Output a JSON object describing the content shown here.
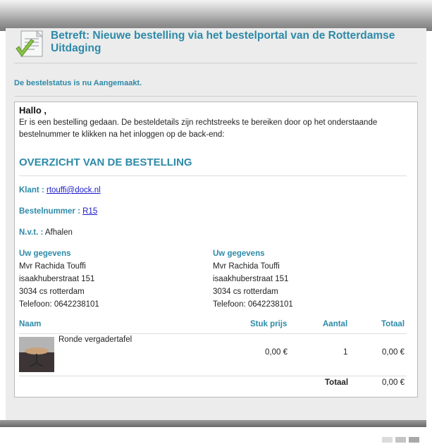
{
  "header": {
    "title": "Betreft: Nieuwe bestelling via het bestelportal van de Rotterdamse Uitdaging",
    "icon": "document-check-icon"
  },
  "status_text": "De bestelstatus is nu Aangemaakt.",
  "mail": {
    "greeting": "Hallo ,",
    "intro": "Er is een bestelling gedaan. De besteldetails zijn rechtstreeks te bereiken door op het onderstaande bestelnummer te klikken na het inloggen op de back-end:",
    "overview_title": "OVERZICHT VAN DE BESTELLING",
    "klant_label": "Klant :",
    "klant_value": "rtouffi@dock.nl",
    "bestelnummer_label": "Bestelnummer :",
    "bestelnummer_value": "R15",
    "nvt_label": "N.v.t. :",
    "nvt_value": "Afhalen",
    "left_details": {
      "heading": "Uw gegevens",
      "name": "Mvr Rachida Touffi",
      "street": "isaakhuberstraat 151",
      "city": "3034 cs rotterdam",
      "phone": "Telefoon: 0642238101"
    },
    "right_details": {
      "heading": "Uw gegevens",
      "name": "Mvr Rachida Touffi",
      "street": "isaakhuberstraat 151",
      "city": "3034 cs rotterdam",
      "phone": "Telefoon: 0642238101"
    },
    "table": {
      "headers": {
        "naam": "Naam",
        "stuk_prijs": "Stuk prijs",
        "aantal": "Aantal",
        "totaal": "Totaal"
      },
      "rows": [
        {
          "naam": "Ronde vergadertafel",
          "stuk_prijs": "0,00 €",
          "aantal": "1",
          "totaal": "0,00 €"
        }
      ],
      "total_label": "Totaal",
      "total_value": "0,00 €"
    }
  },
  "colors": {
    "accent": "#2d8aa8",
    "link": "#1a1acd",
    "background": "#ececec"
  }
}
